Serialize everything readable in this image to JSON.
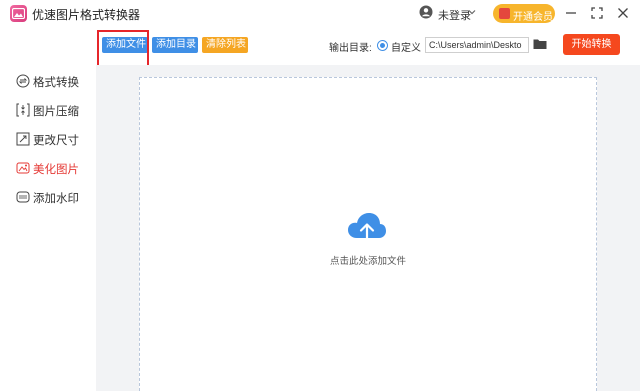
{
  "app": {
    "title": "优速图片格式转换器",
    "login_text": "未登录",
    "vip_label": "开通会员",
    "colors": {
      "accent": "#3f8fe6",
      "vip": "#f7b52c",
      "start": "#f5481e",
      "active_nav": "#e53935",
      "highlight": "#e6262b"
    }
  },
  "toolbar": {
    "add_file": "添加文件",
    "add_dir": "添加目录",
    "clear_list": "清除列表",
    "output_label": "输出目录:",
    "radio_label": "自定义",
    "output_path": "C:\\Users\\admin\\Deskto",
    "start": "开始转换"
  },
  "sidebar": {
    "items": [
      {
        "label": "格式转换",
        "icon": "format-convert-icon",
        "active": false
      },
      {
        "label": "图片压缩",
        "icon": "compress-icon",
        "active": false
      },
      {
        "label": "更改尺寸",
        "icon": "resize-icon",
        "active": false
      },
      {
        "label": "美化图片",
        "icon": "beautify-icon",
        "active": true
      },
      {
        "label": "添加水印",
        "icon": "watermark-icon",
        "active": false
      }
    ]
  },
  "main": {
    "drop_hint": "点击此处添加文件",
    "icon": "cloud-upload-icon"
  }
}
